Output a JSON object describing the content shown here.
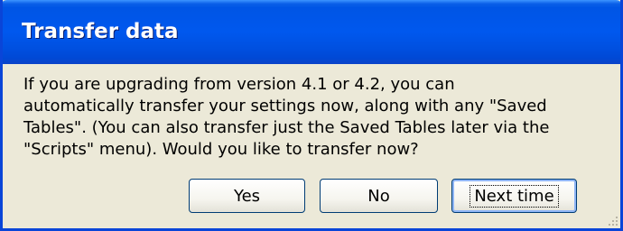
{
  "dialog": {
    "title": "Transfer data",
    "message": "If you are upgrading from version 4.1 or 4.2, you can\nautomatically transfer your settings now, along with any \"Saved\nTables\".  (You can also transfer just the Saved Tables later via the\n\"Scripts\" menu).  Would you like to transfer now?",
    "buttons": {
      "yes": "Yes",
      "no": "No",
      "next_time": "Next time"
    },
    "focused_button": "next_time"
  },
  "colors": {
    "titlebar": "#0055E5",
    "face": "#ECE9D8",
    "button_border": "#003C74"
  },
  "icons": {
    "resize_grip": "resize-grip-icon"
  }
}
